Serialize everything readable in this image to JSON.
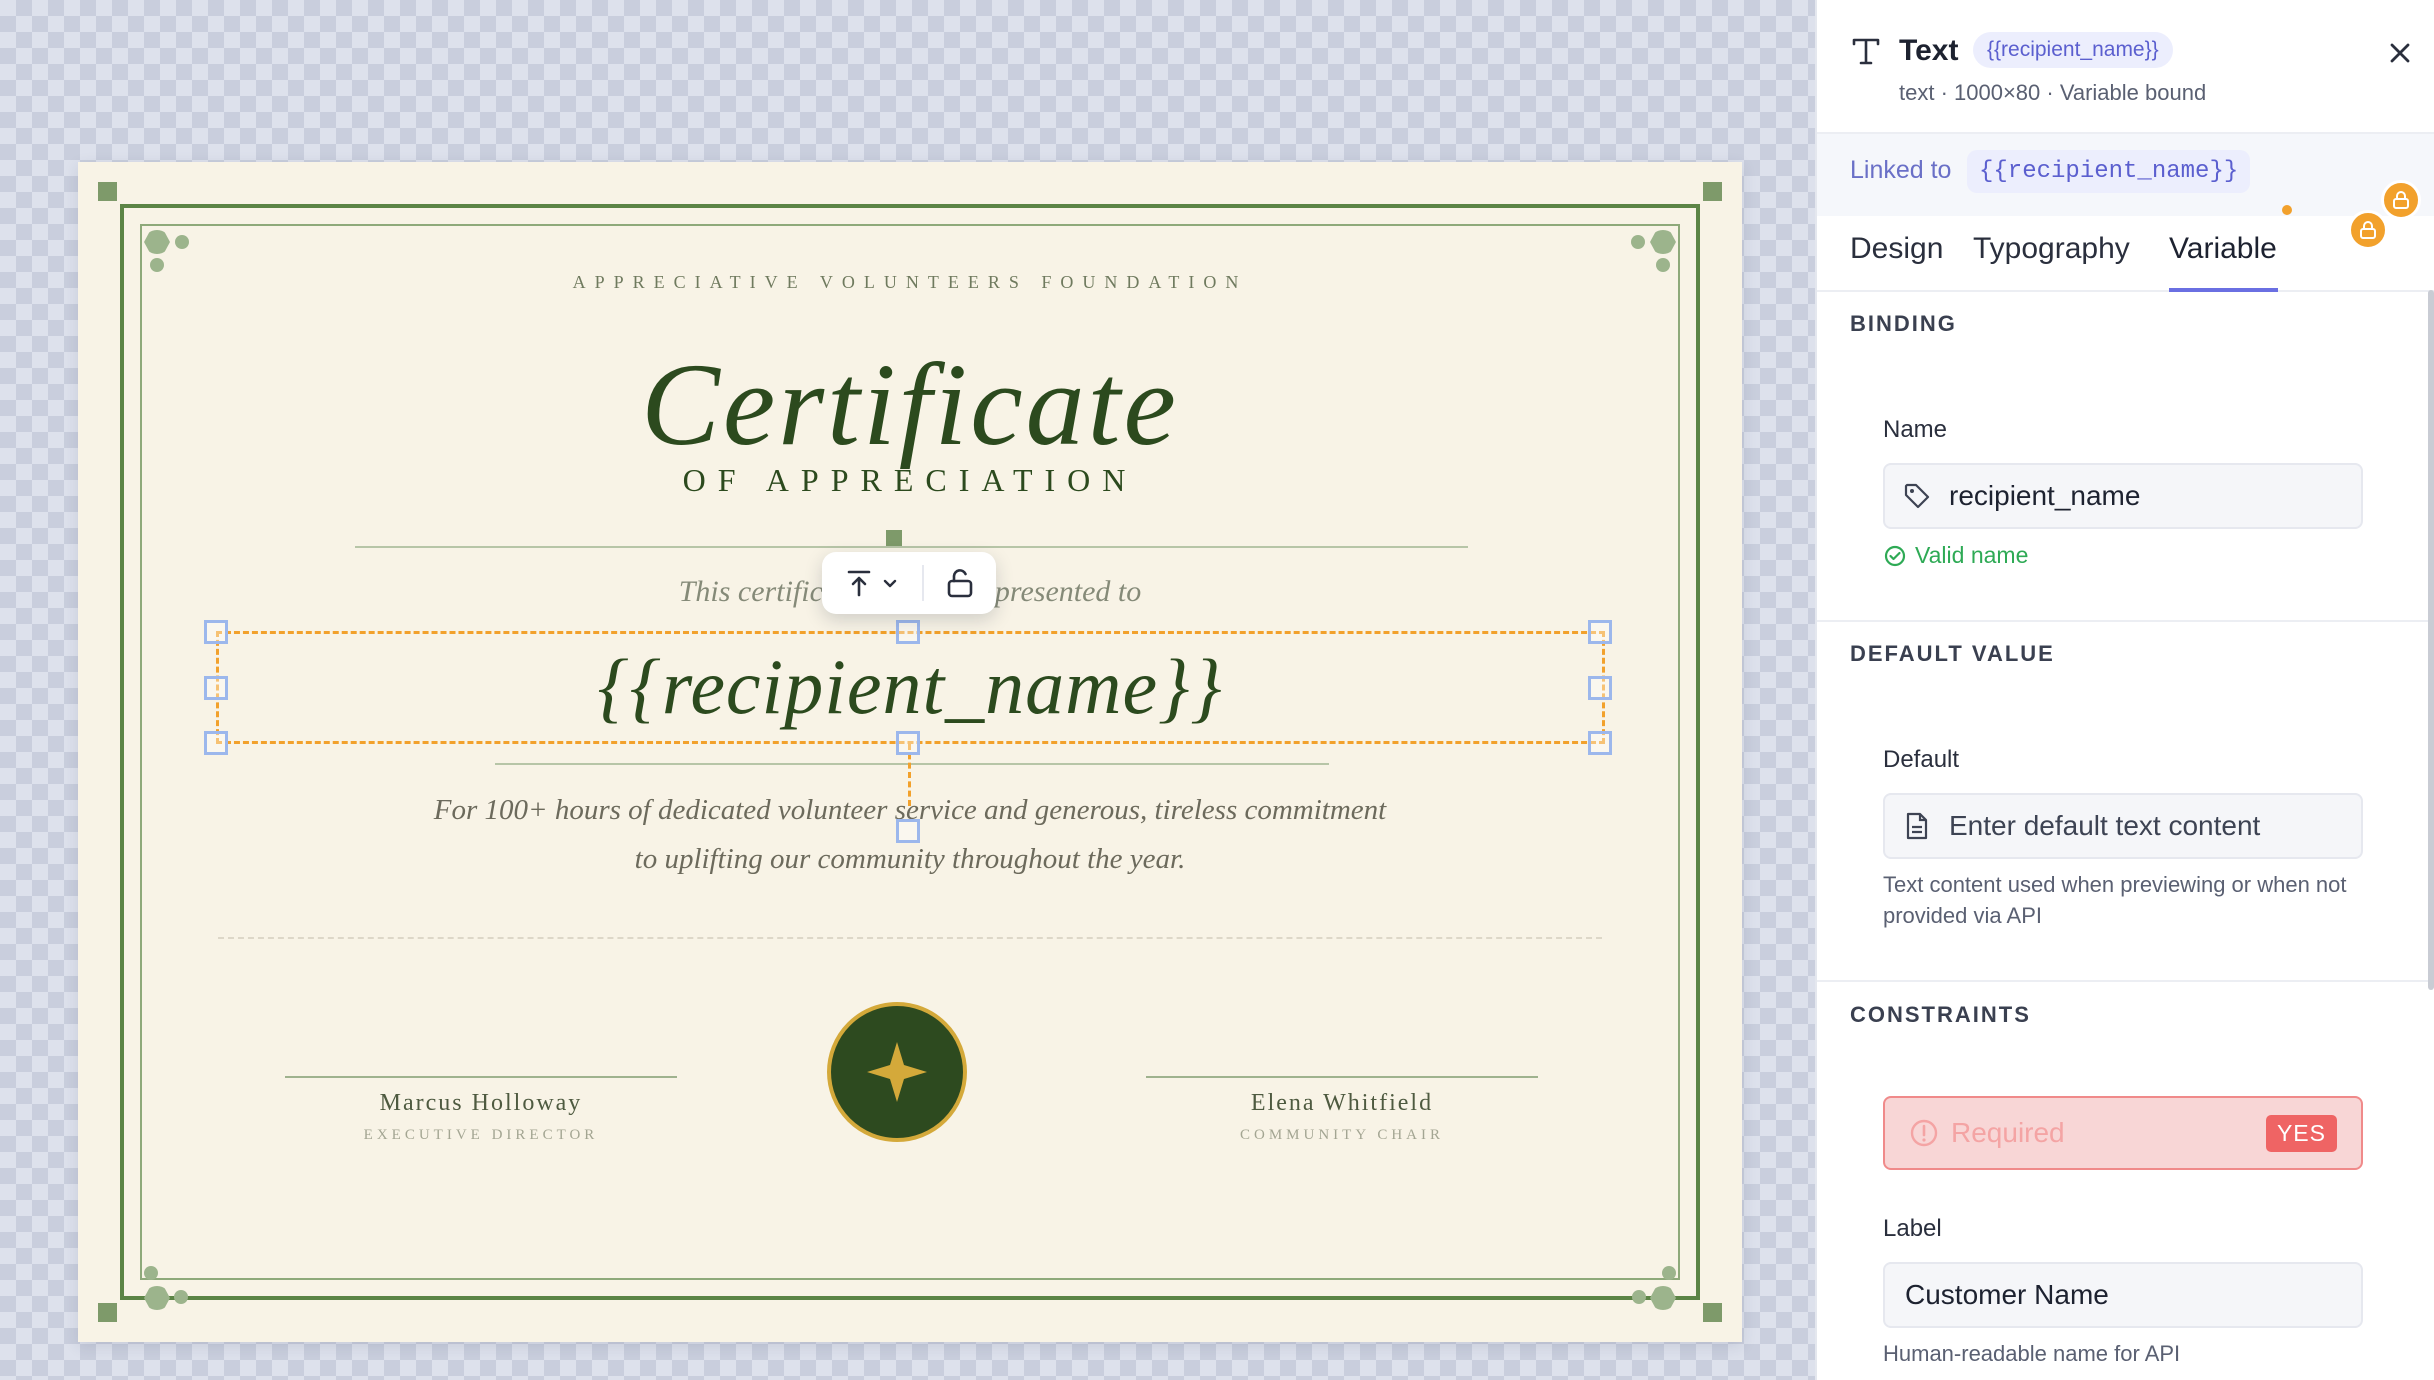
{
  "canvas": {
    "certificate": {
      "foundation": "APPRECIATIVE VOLUNTEERS FOUNDATION",
      "title": "Certificate",
      "subtitle": "OF APPRECIATION",
      "presented_left": "This certific",
      "presented_right": "presented to",
      "recipient_placeholder": "{{recipient_name}}",
      "description_line1": "For 100+ hours of dedicated volunteer service and generous, tireless commitment",
      "description_line2": "to uplifting our community throughout the year.",
      "signatory_left": {
        "name": "Marcus Holloway",
        "role": "EXECUTIVE DIRECTOR"
      },
      "signatory_right": {
        "name": "Elena Whitfield",
        "role": "COMMUNITY CHAIR"
      },
      "seal_icon": "four-point-star-icon"
    },
    "floating_toolbar": {
      "icons": [
        "align-top-icon",
        "chevron-down-icon",
        "unlock-icon"
      ]
    }
  },
  "panel": {
    "header": {
      "type_icon": "text-type-icon",
      "title": "Text",
      "variable_chip": "{{recipient_name}}",
      "meta": "text · 1000×80 · Variable bound",
      "close_icon": "close-icon"
    },
    "linked": {
      "label": "Linked to",
      "variable": "{{recipient_name}}"
    },
    "tabs": [
      {
        "label": "Design",
        "active": false
      },
      {
        "label": "Typography",
        "active": false
      },
      {
        "label": "Variable",
        "active": true
      }
    ],
    "lock_icons": [
      "lock-icon",
      "lock-icon"
    ],
    "binding": {
      "section_title": "BINDING",
      "name_label": "Name",
      "name_value": "recipient_name",
      "name_icon": "tag-icon",
      "valid_text": "Valid name",
      "valid_icon": "check-circle-icon"
    },
    "default_value": {
      "section_title": "DEFAULT VALUE",
      "label": "Default",
      "placeholder": "Enter default text content",
      "icon": "file-text-icon",
      "help": "Text content used when previewing or when not provided via API"
    },
    "constraints": {
      "section_title": "CONSTRAINTS",
      "required_label": "Required",
      "required_value": "YES",
      "required_icon": "alert-circle-icon",
      "label_label": "Label",
      "label_value": "Customer Name",
      "label_help": "Human-readable name for API"
    },
    "colors": {
      "accent": "#6a6fe2",
      "selection": "#f2a12c",
      "valid": "#2eaa55",
      "required": "#ef6464",
      "certificate_green": "#2c4a1e"
    }
  }
}
